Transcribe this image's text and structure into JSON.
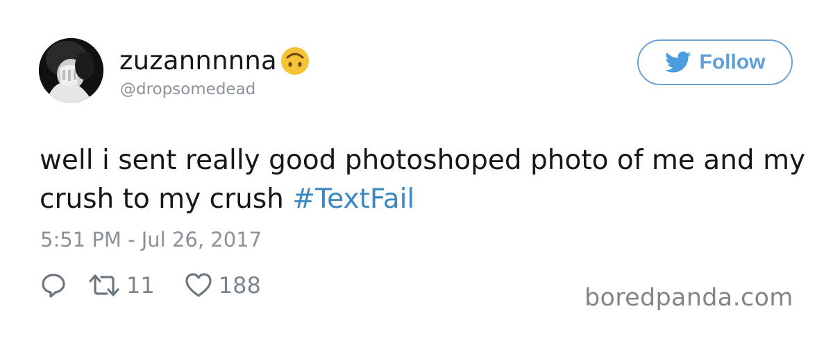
{
  "user": {
    "display_name": "zuzannnnna",
    "handle": "@dropsomedead",
    "avatar_icon": "avatar-photo",
    "name_emoji": "upside-down-face-icon"
  },
  "follow_button": {
    "label": "Follow",
    "icon": "twitter-bird-icon",
    "color": "#5e9ed6"
  },
  "tweet": {
    "text": "well i sent really good photoshoped photo of me and my crush to my crush ",
    "hashtag": "#TextFail",
    "hashtag_color": "#3b88c3",
    "timestamp": "5:51 PM - Jul 26, 2017"
  },
  "actions": {
    "reply": {
      "icon": "reply-icon"
    },
    "retweet": {
      "icon": "retweet-icon",
      "count": "11"
    },
    "like": {
      "icon": "heart-icon",
      "count": "188"
    }
  },
  "watermark": "boredpanda.com"
}
